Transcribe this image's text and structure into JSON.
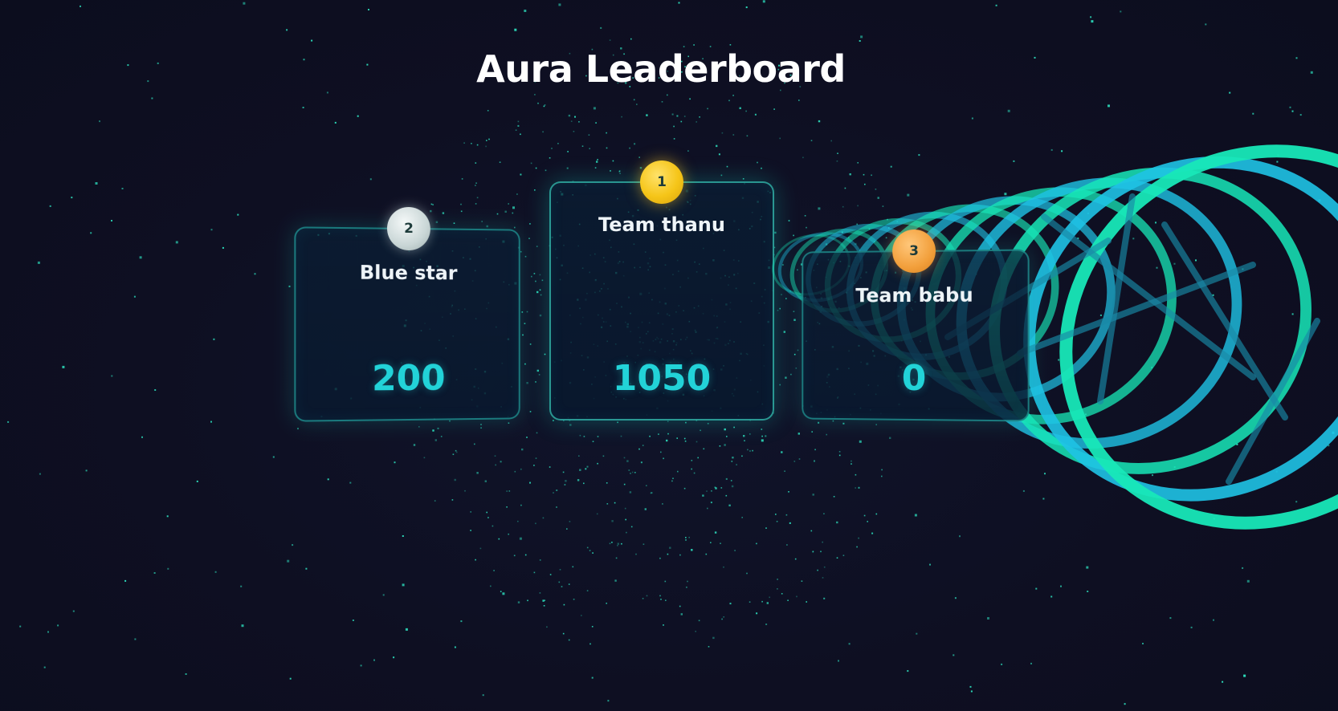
{
  "page": {
    "title": "Aura Leaderboard"
  },
  "leaderboard": {
    "teams": [
      {
        "rank": "1",
        "name": "Team thanu",
        "score": "1050",
        "medal_color": "#f5c518"
      },
      {
        "rank": "2",
        "name": "Blue star",
        "score": "200",
        "medal_color": "#c9d6d6"
      },
      {
        "rank": "3",
        "name": "Team babu",
        "score": "0",
        "medal_color": "#f29f3b"
      }
    ]
  },
  "theme": {
    "background": "#0e0f22",
    "accent": "#22d3d8",
    "particle": "#2ee6c3",
    "spiral_cyan": "#1fc3e6",
    "spiral_green": "#18e8b8"
  }
}
